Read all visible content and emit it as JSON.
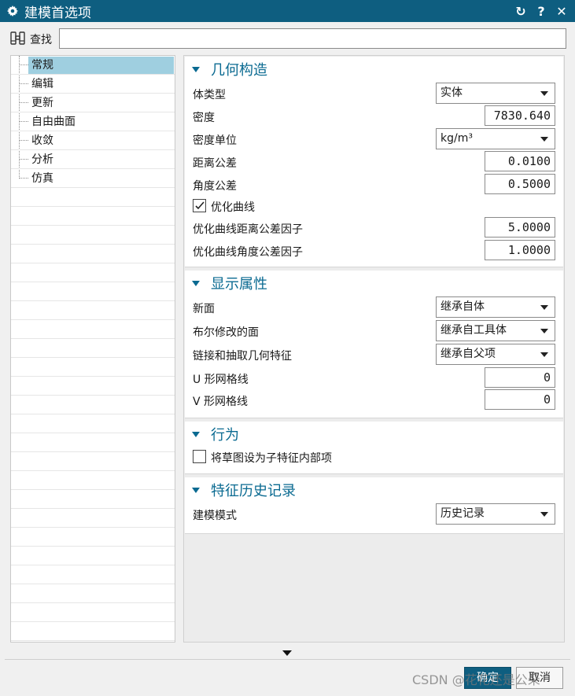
{
  "window": {
    "title": "建模首选项",
    "reset_label": "↻",
    "help_label": "?",
    "close_label": "✕"
  },
  "find": {
    "label": "查找",
    "value": ""
  },
  "tree": {
    "items": [
      {
        "label": "常规",
        "selected": true
      },
      {
        "label": "编辑"
      },
      {
        "label": "更新"
      },
      {
        "label": "自由曲面"
      },
      {
        "label": "收敛"
      },
      {
        "label": "分析"
      },
      {
        "label": "仿真"
      }
    ]
  },
  "geometry": {
    "header": "几何构造",
    "body_type_label": "体类型",
    "body_type_value": "实体",
    "density_label": "密度",
    "density_value": "7830.640",
    "density_unit_label": "密度单位",
    "density_unit_value": "kg/m³",
    "distance_tol_label": "距离公差",
    "distance_tol_value": "0.0100",
    "angle_tol_label": "角度公差",
    "angle_tol_value": "0.5000",
    "optimize_label": "优化曲线",
    "optimize_checked": true,
    "opt_dist_label": "优化曲线距离公差因子",
    "opt_dist_value": "5.0000",
    "opt_angle_label": "优化曲线角度公差因子",
    "opt_angle_value": "1.0000"
  },
  "display": {
    "header": "显示属性",
    "new_face_label": "新面",
    "new_face_value": "继承自体",
    "boolean_label": "布尔修改的面",
    "boolean_value": "继承自工具体",
    "link_label": "链接和抽取几何特征",
    "link_value": "继承自父项",
    "u_grid_label": "U 形网格线",
    "u_grid_value": "0",
    "v_grid_label": "V 形网格线",
    "v_grid_value": "0"
  },
  "behavior": {
    "header": "行为",
    "sketch_label": "将草图设为子特征内部项",
    "sketch_checked": false
  },
  "history": {
    "header": "特征历史记录",
    "mode_label": "建模模式",
    "mode_value": "历史记录"
  },
  "buttons": {
    "ok": "确定",
    "cancel": "取消"
  },
  "watermark": "CSDN @花花还是公朵",
  "colors": {
    "titlebar": "#0e5e80",
    "accent": "#0a6a91",
    "selection": "#9fcfe0"
  }
}
